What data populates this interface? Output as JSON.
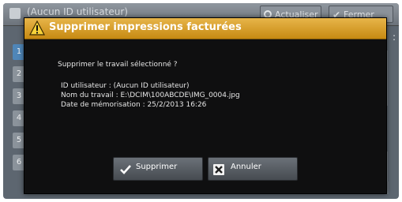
{
  "background": {
    "title": "(Aucun ID utilisateur)",
    "buttons": {
      "refresh": "Actualiser",
      "close": "Fermer"
    },
    "tabs": [
      "1",
      "2",
      "3",
      "4",
      "5",
      "6"
    ]
  },
  "dialog": {
    "title": "Supprimer impressions facturées",
    "question": "Supprimer le travail sélectionné ?",
    "details": [
      "ID utilisateur : (Aucun ID utilisateur)",
      "Nom du travail : E:\\DCIM\\100ABCDE\\IMG_0004.jpg",
      "Date de mémorisation : 25/2/2013 16:26"
    ],
    "buttons": {
      "confirm": "Supprimer",
      "cancel": "Annuler"
    }
  },
  "colors": {
    "title_bar": "#d69d2a",
    "dialog_bg": "#0f0f10",
    "background_panel": "#5d6670"
  },
  "icons": {
    "title": "warning-icon",
    "confirm": "check-icon",
    "cancel": "x-icon"
  }
}
